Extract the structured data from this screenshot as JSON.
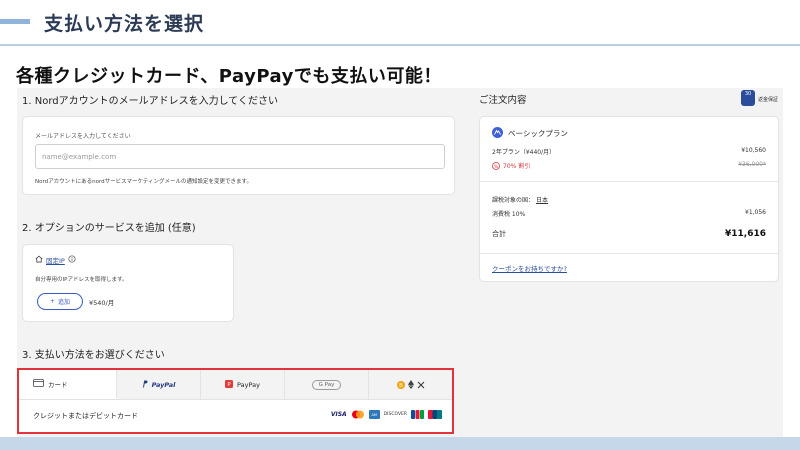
{
  "slide": {
    "section_title": "支払い方法を選択",
    "headline": "各種クレジットカード、PayPayでも支払い可能！"
  },
  "checkout": {
    "step1": {
      "title": "1. Nordアカウントのメールアドレスを入力してください",
      "label": "メールアドレスを入力してください",
      "placeholder": "name@example.com",
      "note": "Nordアカウントにあるnordサービスマーケティングメールの通知設定を変更できます。"
    },
    "step2": {
      "title": "2. オプションのサービスを追加 (任意)",
      "option_name": "固定IP",
      "option_desc": "自分専用のIPアドレスを取得します。",
      "add_label": "追加",
      "price": "¥540/月"
    },
    "step3": {
      "title": "3. 支払い方法をお選びください",
      "tabs": [
        {
          "label": "カード",
          "icon": "credit-card-icon"
        },
        {
          "label": "PayPal",
          "icon": "paypal-icon"
        },
        {
          "label": "PayPay",
          "icon": "paypay-icon"
        },
        {
          "label": "G Pay",
          "icon": "google-pay-icon"
        },
        {
          "label": "",
          "icon": "crypto-icon"
        }
      ],
      "selected_method": "クレジットまたはデビットカード",
      "brands": [
        "VISA",
        "Mastercard",
        "AMEX",
        "DISCOVER",
        "JCB",
        "UnionPay"
      ]
    },
    "summary": {
      "title": "ご注文内容",
      "badge_days": "30",
      "badge_label": "返金保証",
      "plan_name": "ベーシックプラン",
      "plan_term": "2年プラン（¥440/月）",
      "plan_price": "¥10,560",
      "discount": "70% 割引",
      "original_price": "¥36,000*",
      "tax_country_label": "課税対象の国：",
      "tax_country": "日本",
      "tax_label": "消費税 10%",
      "tax_value": "¥1,056",
      "total_label": "合計",
      "total_value": "¥11,616",
      "coupon": "クーポンをお持ちですか?"
    }
  },
  "colors": {
    "highlight": "#e2333a",
    "link": "#2a4d9c",
    "discount": "#d8383e",
    "band_accent": "#8fb3d9"
  }
}
